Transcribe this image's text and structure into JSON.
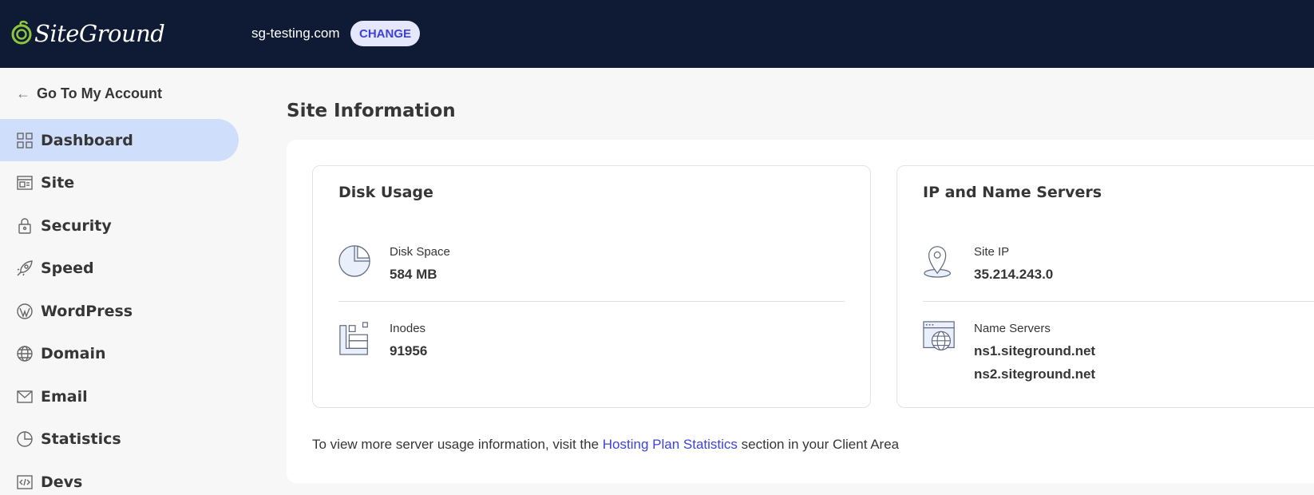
{
  "header": {
    "logo_text": "SiteGround",
    "site_name": "sg-testing.com",
    "change_label": "CHANGE"
  },
  "sidebar": {
    "back_label": "Go To My Account",
    "items": [
      {
        "label": "Dashboard",
        "icon": "dashboard-icon",
        "active": true
      },
      {
        "label": "Site",
        "icon": "site-icon"
      },
      {
        "label": "Security",
        "icon": "lock-icon"
      },
      {
        "label": "Speed",
        "icon": "rocket-icon"
      },
      {
        "label": "WordPress",
        "icon": "wordpress-icon"
      },
      {
        "label": "Domain",
        "icon": "globe-icon"
      },
      {
        "label": "Email",
        "icon": "envelope-icon"
      },
      {
        "label": "Statistics",
        "icon": "pie-chart-icon"
      },
      {
        "label": "Devs",
        "icon": "code-icon"
      }
    ]
  },
  "main": {
    "title": "Site Information",
    "disk_usage": {
      "title": "Disk Usage",
      "disk_space_label": "Disk Space",
      "disk_space_value": "584 MB",
      "inodes_label": "Inodes",
      "inodes_value": "91956"
    },
    "ip_servers": {
      "title": "IP and Name Servers",
      "site_ip_label": "Site IP",
      "site_ip_value": "35.214.243.0",
      "name_servers_label": "Name Servers",
      "ns1": "ns1.siteground.net",
      "ns2": "ns2.siteground.net"
    },
    "footer": {
      "prefix": "To view more server usage information, visit the ",
      "link": "Hosting Plan Statistics",
      "suffix": " section in your Client Area"
    }
  },
  "colors": {
    "header_bg": "#0f1a35",
    "accent": "#3d43d8",
    "active_nav_bg": "#cfdefb",
    "logo_green": "#8cc63f"
  }
}
